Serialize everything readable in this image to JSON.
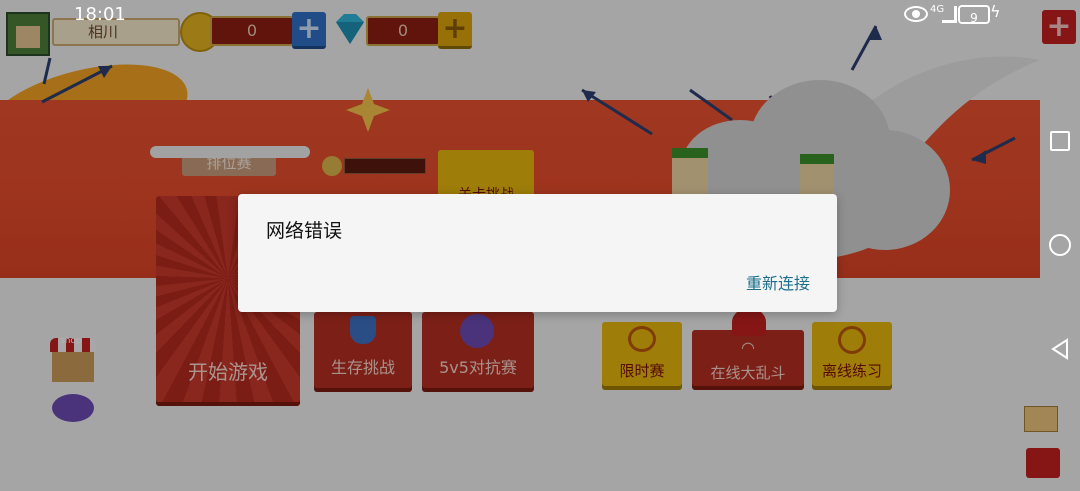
{
  "status_bar": {
    "time": "18:01",
    "signal_label": "4G",
    "battery": "9"
  },
  "player": {
    "name": "相川"
  },
  "currency": {
    "coins": "0",
    "gems": "0"
  },
  "modes": {
    "ranked_label": "排位赛",
    "start_game": "开始游戏",
    "survival": "生存挑战",
    "five_vs_five": "5v5对抗赛",
    "limited_time": "限时赛",
    "online_brawl": "在线大乱斗",
    "offline_practice": "离线练习",
    "new_challenge_partial": "关卡挑战"
  },
  "shop": {
    "sign": "shop"
  },
  "dialog": {
    "title": "网络错误",
    "retry_label": "重新连接"
  },
  "icons": [
    "eye-icon",
    "battery-icon",
    "charging-icon",
    "plus-icon",
    "gem-icon",
    "coin-icon",
    "mail-icon",
    "square-nav-icon",
    "circle-nav-icon",
    "back-nav-icon"
  ],
  "colors": {
    "accent_red": "#b22f21",
    "accent_yellow": "#e3b40e",
    "dialog_button": "#1d6f8a",
    "banner": "#e14a2a"
  }
}
